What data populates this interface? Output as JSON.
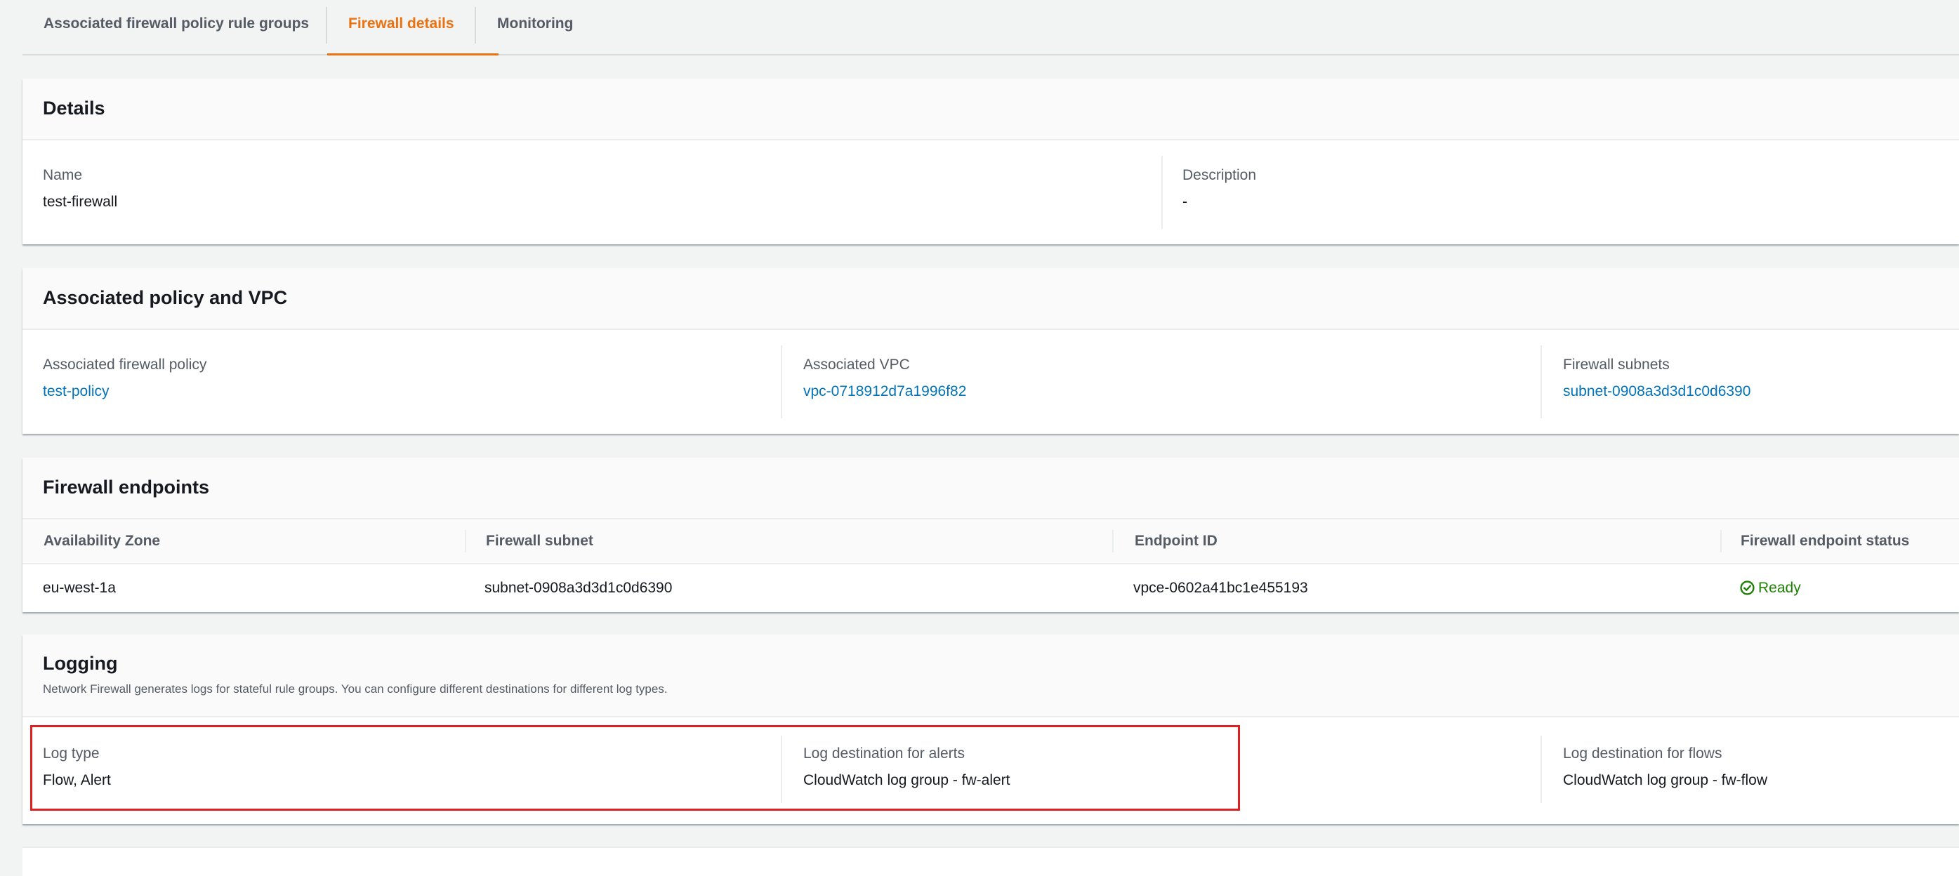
{
  "tabs": [
    {
      "label": "Associated firewall policy rule groups"
    },
    {
      "label": "Firewall details"
    },
    {
      "label": "Monitoring"
    }
  ],
  "details": {
    "title": "Details",
    "name_label": "Name",
    "name_value": "test-firewall",
    "description_label": "Description",
    "description_value": "-"
  },
  "policy_vpc": {
    "title": "Associated policy and VPC",
    "policy_label": "Associated firewall policy",
    "policy_value": "test-policy",
    "vpc_label": "Associated VPC",
    "vpc_value": "vpc-0718912d7a1996f82",
    "subnets_label": "Firewall subnets",
    "subnets_value": "subnet-0908a3d3d1c0d6390"
  },
  "endpoints": {
    "title": "Firewall endpoints",
    "columns": [
      "Availability Zone",
      "Firewall subnet",
      "Endpoint ID",
      "Firewall endpoint status"
    ],
    "rows": [
      [
        "eu-west-1a",
        "subnet-0908a3d3d1c0d6390",
        "vpce-0602a41bc1e455193",
        "Ready"
      ]
    ]
  },
  "logging": {
    "title": "Logging",
    "description": "Network Firewall generates logs for stateful rule groups. You can configure different destinations for different log types.",
    "log_type_label": "Log type",
    "log_type_value": "Flow, Alert",
    "alerts_label": "Log destination for alerts",
    "alerts_value": "CloudWatch log group - fw-alert",
    "flows_label": "Log destination for flows",
    "flows_value": "CloudWatch log group - fw-flow"
  },
  "colors": {
    "active_tab": "#ec7211",
    "link": "#0073bb",
    "status_ok": "#1d8102",
    "highlight": "#e02020"
  },
  "icons": {
    "status_ready": "check-circle-icon"
  }
}
